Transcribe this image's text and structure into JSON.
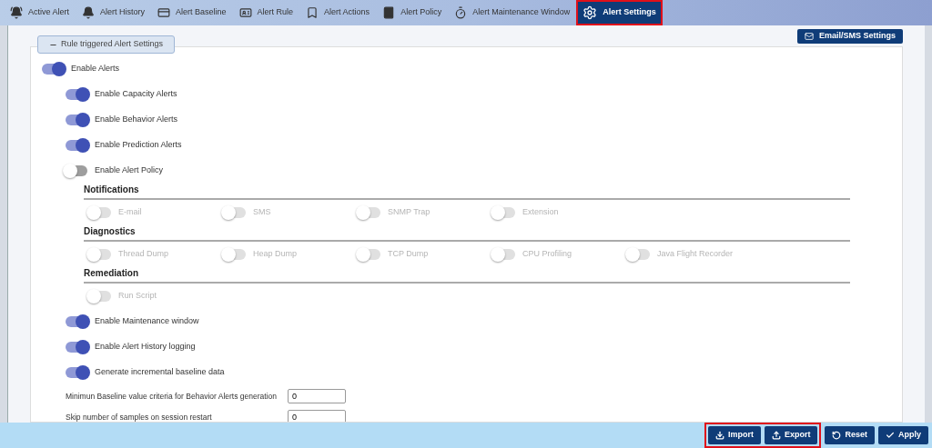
{
  "tabs": [
    {
      "label": "Active Alert",
      "selected": false
    },
    {
      "label": "Alert History",
      "selected": false
    },
    {
      "label": "Alert Baseline",
      "selected": false
    },
    {
      "label": "Alert Rule",
      "selected": false
    },
    {
      "label": "Alert Actions",
      "selected": false
    },
    {
      "label": "Alert Policy",
      "selected": false
    },
    {
      "label": "Alert Maintenance Window",
      "selected": false
    },
    {
      "label": "Alert Settings",
      "selected": true,
      "highlighted": true
    }
  ],
  "email_sms_button": "Email/SMS Settings",
  "group_legend": "Rule triggered Alert Settings",
  "main_toggle": {
    "label": "Enable Alerts",
    "on": true
  },
  "toggles": [
    {
      "label": "Enable Capacity Alerts",
      "on": true
    },
    {
      "label": "Enable Behavior Alerts",
      "on": true
    },
    {
      "label": "Enable Prediction Alerts",
      "on": true
    },
    {
      "label": "Enable Alert Policy",
      "on": false
    }
  ],
  "sections": [
    {
      "title": "Notifications",
      "items": [
        {
          "label": "E-mail",
          "on": false,
          "disabled": true
        },
        {
          "label": "SMS",
          "on": false,
          "disabled": true
        },
        {
          "label": "SNMP Trap",
          "on": false,
          "disabled": true
        },
        {
          "label": "Extension",
          "on": false,
          "disabled": true
        }
      ]
    },
    {
      "title": "Diagnostics",
      "items": [
        {
          "label": "Thread Dump",
          "on": false,
          "disabled": true
        },
        {
          "label": "Heap Dump",
          "on": false,
          "disabled": true
        },
        {
          "label": "TCP Dump",
          "on": false,
          "disabled": true
        },
        {
          "label": "CPU Profiling",
          "on": false,
          "disabled": true
        },
        {
          "label": "Java Flight Recorder",
          "on": false,
          "disabled": true
        }
      ]
    },
    {
      "title": "Remediation",
      "items": [
        {
          "label": "Run Script",
          "on": false,
          "disabled": true
        }
      ]
    }
  ],
  "more_toggles": [
    {
      "label": "Enable Maintenance window",
      "on": true
    },
    {
      "label": "Enable Alert History logging",
      "on": true
    },
    {
      "label": "Generate incremental baseline data",
      "on": true
    }
  ],
  "fields": [
    {
      "label": "Minimun Baseline value criteria for Behavior Alerts generation",
      "value": "0"
    },
    {
      "label": "Skip number of samples on session restart",
      "value": "0"
    }
  ],
  "footer": {
    "highlighted_buttons": [
      {
        "label": "Import",
        "kind": "import"
      },
      {
        "label": "Export",
        "kind": "export"
      }
    ],
    "buttons": [
      {
        "label": "Reset",
        "kind": "reset"
      },
      {
        "label": "Apply",
        "kind": "apply"
      }
    ]
  }
}
